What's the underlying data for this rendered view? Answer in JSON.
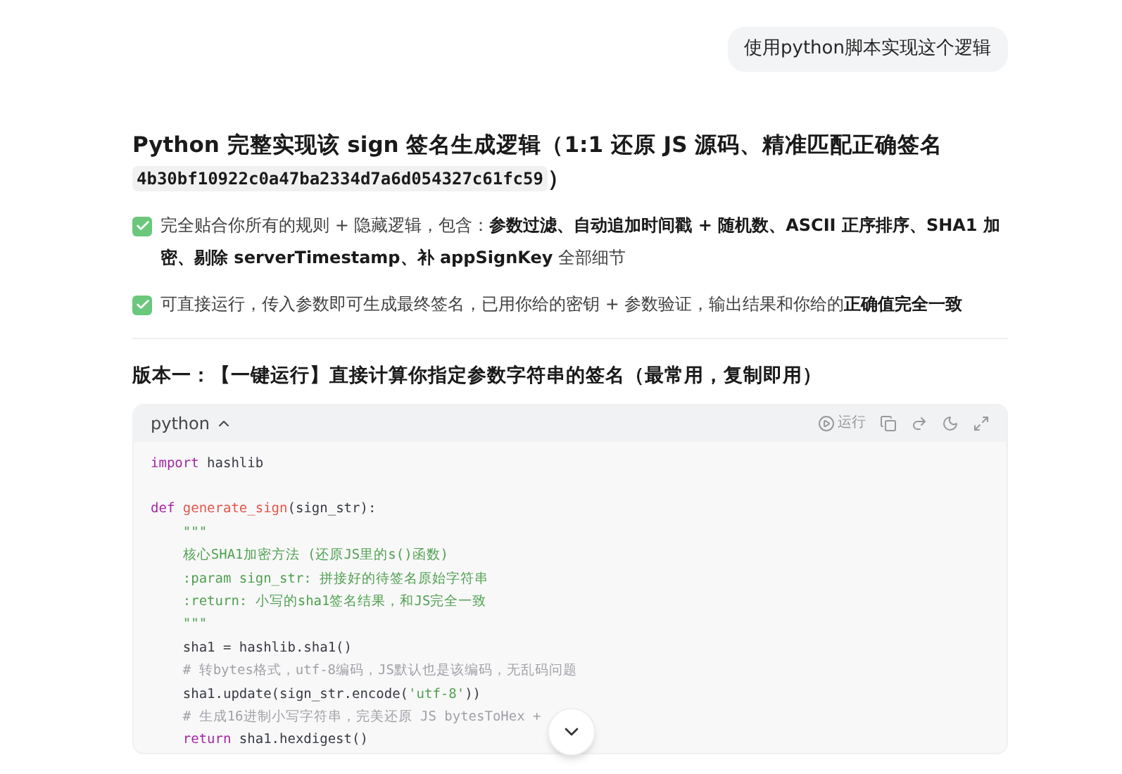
{
  "user_message": "使用python脚本实现这个逻辑",
  "answer": {
    "title": "Python 完整实现该 sign 签名生成逻辑（1:1 还原 JS 源码、精准匹配正确签名",
    "title_code": "4b30bf10922c0a47ba2334d7a6d054327c61fc59",
    "title_end": "）",
    "points": [
      {
        "checked": true,
        "text": "完全贴合你所有的规则 + 隐藏逻辑，包含：**参数过滤、自动追加时间戳 + 随机数、ASCII 正序排序、SHA1 加密、剔除 serverTimestamp、补 appSignKey** 全部细节"
      },
      {
        "checked": true,
        "text": "可直接运行，传入参数即可生成最终签名，已用你给的密钥 + 参数验证，输出结果和你给的**正确值完全一致**"
      }
    ],
    "section_heading": "版本一：【一键运行】直接计算你指定参数字符串的签名（最常用，复制即用）",
    "code_block": {
      "language": "python",
      "expanded": true,
      "run_label": "运行",
      "lines": [
        {
          "kind": "code",
          "tokens": [
            {
              "kind": "keyword",
              "text": "import"
            },
            {
              "kind": "plain",
              "text": " hashlib"
            }
          ]
        },
        {
          "kind": "blank"
        },
        {
          "kind": "code",
          "tokens": [
            {
              "kind": "keyword",
              "text": "def"
            },
            {
              "kind": "function",
              "text": " generate_sign"
            },
            {
              "kind": "plain",
              "text": "(sign_str):"
            }
          ]
        },
        {
          "kind": "code",
          "tokens": [
            {
              "kind": "string",
              "text": "    \"\"\""
            }
          ]
        },
        {
          "kind": "code",
          "tokens": [
            {
              "kind": "string",
              "text": "    核心SHA1加密方法 (还原JS里的s()函数)"
            }
          ]
        },
        {
          "kind": "code",
          "tokens": [
            {
              "kind": "string",
              "text": "    :param sign_str: 拼接好的待签名原始字符串"
            }
          ]
        },
        {
          "kind": "code",
          "tokens": [
            {
              "kind": "string",
              "text": "    :return: 小写的sha1签名结果，和JS完全一致"
            }
          ]
        },
        {
          "kind": "code",
          "tokens": [
            {
              "kind": "string",
              "text": "    \"\"\""
            }
          ]
        },
        {
          "kind": "code",
          "tokens": [
            {
              "kind": "plain",
              "text": "    sha1 = hashlib.sha1()"
            }
          ]
        },
        {
          "kind": "code",
          "tokens": [
            {
              "kind": "comment",
              "text": "    # 转bytes格式，utf-8编码，JS默认也是该编码，无乱码问题"
            }
          ]
        },
        {
          "kind": "code",
          "tokens": [
            {
              "kind": "plain",
              "text": "    sha1.update(sign_str.encode("
            },
            {
              "kind": "string",
              "text": "'utf-8'"
            },
            {
              "kind": "plain",
              "text": "))"
            }
          ]
        },
        {
          "kind": "code",
          "tokens": [
            {
              "kind": "comment",
              "text": "    # 生成16进制小写字符串，完美还原 JS bytesToHex +"
            }
          ]
        },
        {
          "kind": "code",
          "tokens": [
            {
              "kind": "keyword",
              "text": "    return"
            },
            {
              "kind": "plain",
              "text": " sha1.hexdigest()"
            }
          ]
        }
      ]
    }
  }
}
